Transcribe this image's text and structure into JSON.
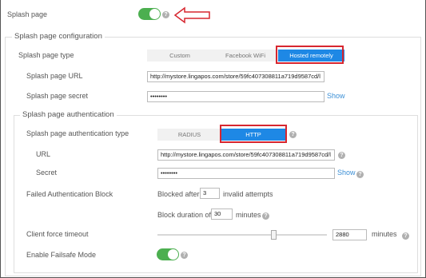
{
  "splash_page": {
    "label": "Splash page",
    "enabled": true
  },
  "config": {
    "legend": "Splash page configuration",
    "type_label": "Splash page type",
    "type_options": [
      "Custom",
      "Facebook WiFi",
      "Hosted remotely"
    ],
    "selected_type": "Hosted remotely",
    "url_label": "Splash page URL",
    "url_value": "http://mystore.lingapos.com/store/59fc407308811a719d9587cd/l",
    "secret_label": "Splash page secret",
    "secret_value": "••••••••",
    "show_label": "Show"
  },
  "auth": {
    "legend": "Splash page authentication",
    "type_label": "Splash page authentication type",
    "type_options": [
      "RADIUS",
      "HTTP"
    ],
    "selected_type": "HTTP",
    "url_label": "URL",
    "url_value": "http://mystore.lingapos.com/store/59fc407308811a719d9587cd/l",
    "secret_label": "Secret",
    "secret_value": "••••••••",
    "show_label": "Show",
    "failed_block_label": "Failed Authentication Block",
    "blocked_after_prefix": "Blocked after",
    "blocked_after_value": "3",
    "blocked_after_suffix": "invalid attempts",
    "block_duration_prefix": "Block duration of",
    "block_duration_value": "30",
    "block_duration_suffix": "minutes",
    "timeout_label": "Client force timeout",
    "timeout_value": "2880",
    "timeout_unit": "minutes",
    "timeout_slider_fraction": 0.65,
    "failsafe_label": "Enable Failsafe Mode",
    "failsafe_enabled": true
  },
  "icons": {
    "help": "question-circle-icon",
    "arrow": "left-arrow-annotation-icon"
  },
  "colors": {
    "toggle_on": "#4caf50",
    "active_segment": "#1e88e5",
    "annotation_red": "#d7262f",
    "link": "#3b8fd6"
  }
}
